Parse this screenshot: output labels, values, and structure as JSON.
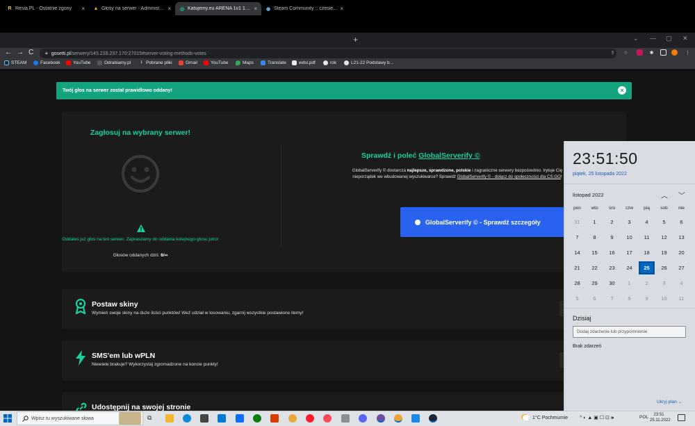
{
  "browser": {
    "tabs": [
      {
        "title": "Resia.PL - Ostatnie zgony",
        "favicon_color": "#f2c94c",
        "favicon_glyph": "R",
        "active": false
      },
      {
        "title": "Głosy na serwer - Administration",
        "favicon_color": "#f4b400",
        "favicon_glyph": "▲",
        "active": false
      },
      {
        "title": "Katujemy.eu ARENA 1v1 128TR |",
        "favicon_color": "#19d39e",
        "favicon_glyph": "◎",
        "active": true
      },
      {
        "title": "Steam Community :: czesiek katu...",
        "favicon_color": "#1b2838",
        "favicon_glyph": "◉",
        "active": false
      }
    ],
    "tab_close": "×",
    "new_tab": "+",
    "window_controls": [
      "⌄",
      "—",
      "▢",
      "✕"
    ],
    "nav": {
      "back": "←",
      "forward": "→",
      "reload": "C"
    },
    "url_host": "gosetti.pl",
    "url_path": "/serwery/145.239.237.170:27015#server-voting-methods-votes",
    "bookmarks": [
      {
        "label": "STEAM",
        "color": "#1b2838"
      },
      {
        "label": "Facebook",
        "color": "#1877f2"
      },
      {
        "label": "YouTube",
        "color": "#ff0000"
      },
      {
        "label": "Odrabiamy.pl",
        "color": "#333333"
      },
      {
        "label": "Pobrane pliki",
        "color": "#e8eaed"
      },
      {
        "label": "Gmail",
        "color": "#ea4335"
      },
      {
        "label": "YouTube",
        "color": "#ff0000"
      },
      {
        "label": "Maps",
        "color": "#34a853"
      },
      {
        "label": "Translate",
        "color": "#4285f4"
      },
      {
        "label": "wdsl.pdf",
        "color": "#e8eaed"
      },
      {
        "label": "rok",
        "color": "#e8eaed"
      },
      {
        "label": "L21-22 Podstawy b...",
        "color": "#e8eaed"
      }
    ]
  },
  "page": {
    "alert": "Twój głos na serwer został prawidłowo oddany!",
    "alert_close": "×",
    "vote": {
      "title": "Zagłosuj na wybrany serwer!",
      "voted_message": "Oddałeś już głos na ten serwer. Zapraszamy do oddania kolejnego głosu jutro!",
      "count_label": "Głosów oddanych dziś:",
      "count_value": "6/∞"
    },
    "globalserverify": {
      "title_prefix": "Sprawdź i poleć",
      "title_link": "GlobalServerify ©",
      "desc_1": "GlobalServerify © dostarcza",
      "desc_bold": "najlepsze, sprawdzone, polskie",
      "desc_2": "i zagraniczne serwery bezpośrednio. Irytuje Cię nieporządek we wbudowanej wyszukiwarce? Sprawdź",
      "desc_link": "GlobalServerify © - dołącz do społeczności dla CS:GO",
      "desc_end": "!",
      "button": "GlobalServerify © - Sprawdź szczegóły"
    },
    "features": [
      {
        "title": "Postaw skiny",
        "desc": "Wymień swoje skiny na duże ilości punktów! Weź udział w losowaniu, zgarnij wszystkie postawione itemy!",
        "icon": "medal-icon"
      },
      {
        "title": "SMS'em lub wPLN",
        "desc": "Niewiele brakuje? Wykorzystaj zgromadzone na koncie punkty!",
        "icon": "lightning-icon"
      },
      {
        "title": "Udostępnij na swojej stronie",
        "desc": "",
        "icon": "link-icon"
      }
    ],
    "accent": "#19d39e"
  },
  "calendar": {
    "time": "23:51:50",
    "date": "piątek, 25 listopada 2022",
    "month": "listopad 2022",
    "weekdays": [
      "pon",
      "wto",
      "śro",
      "czw",
      "pią",
      "sob",
      "nie"
    ],
    "weeks": [
      [
        "31",
        "1",
        "2",
        "3",
        "4",
        "5",
        "6"
      ],
      [
        "7",
        "8",
        "9",
        "10",
        "11",
        "12",
        "13"
      ],
      [
        "14",
        "15",
        "16",
        "17",
        "18",
        "19",
        "20"
      ],
      [
        "21",
        "22",
        "23",
        "24",
        "25",
        "26",
        "27"
      ],
      [
        "28",
        "29",
        "30",
        "1",
        "2",
        "3",
        "4"
      ],
      [
        "5",
        "6",
        "7",
        "8",
        "9",
        "10",
        "11"
      ]
    ],
    "today": "25",
    "today_label": "Dzisiaj",
    "event_placeholder": "Dodaj zdarzenie lub przypomnienie",
    "no_events": "Brak zdarzeń",
    "hide_plan": "Ukryj plan ⌄"
  },
  "taskbar": {
    "search_placeholder": "Wpisz tu wyszukiwane słowa",
    "weather": "1°C  Pochmurnie",
    "tray": "^ ◐ ▲ ▣ ☐ ⊡ 🕪",
    "lang": "POL",
    "time": "23:51",
    "date": "25.11.2022"
  }
}
